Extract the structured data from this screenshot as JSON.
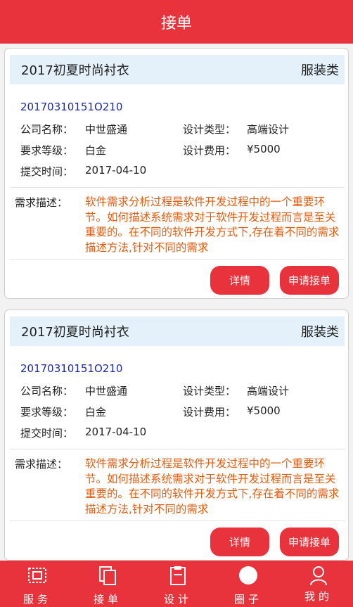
{
  "header": {
    "title": "接单"
  },
  "orders": [
    {
      "title": "2017初夏时尚衬衣",
      "category": "服装类",
      "order_no": "20170310151O210",
      "company_label": "公司名称：",
      "company": "中世盛通",
      "design_type_label": "设计类型：",
      "design_type": "高端设计",
      "level_label": "要求等级：",
      "level": "白金",
      "fee_label": "设计费用：",
      "fee": "¥5000",
      "submit_label": "提交时间：",
      "submit_time": "2017-04-10",
      "desc_label": "需求描述：",
      "desc": "软件需求分析过程是软件开发过程中的一个重要环节。如何描述系统需求对于软件开发过程而言是至关重要的。在不同的软件开发方式下,存在着不同的需求描述方法,针对不同的需求",
      "detail_button": "详情",
      "apply_button": "申请接单"
    },
    {
      "title": "2017初夏时尚衬衣",
      "category": "服装类",
      "order_no": "20170310151O210",
      "company_label": "公司名称：",
      "company": "中世盛通",
      "design_type_label": "设计类型：",
      "design_type": "高端设计",
      "level_label": "要求等级：",
      "level": "白金",
      "fee_label": "设计费用：",
      "fee": "¥5000",
      "submit_label": "提交时间：",
      "submit_time": "2017-04-10",
      "desc_label": "需求描述：",
      "desc": "软件需求分析过程是软件开发过程中的一个重要环节。如何描述系统需求对于软件开发过程而言是至关重要的。在不同的软件开发方式下,存在着不同的需求描述方法,针对不同的需求",
      "detail_button": "详情",
      "apply_button": "申请接单"
    }
  ],
  "tabbar": {
    "items": [
      {
        "label": "服务",
        "icon": "service-icon"
      },
      {
        "label": "接单",
        "icon": "orders-icon"
      },
      {
        "label": "设计",
        "icon": "clipboard-icon"
      },
      {
        "label": "圈子",
        "icon": "circle-icon"
      },
      {
        "label": "我的",
        "icon": "user-icon"
      }
    ]
  },
  "colors": {
    "primary": "#e8333c",
    "title_bg": "#e4f1fb",
    "order_no": "#1a2aa8",
    "desc": "#e35b0c"
  }
}
